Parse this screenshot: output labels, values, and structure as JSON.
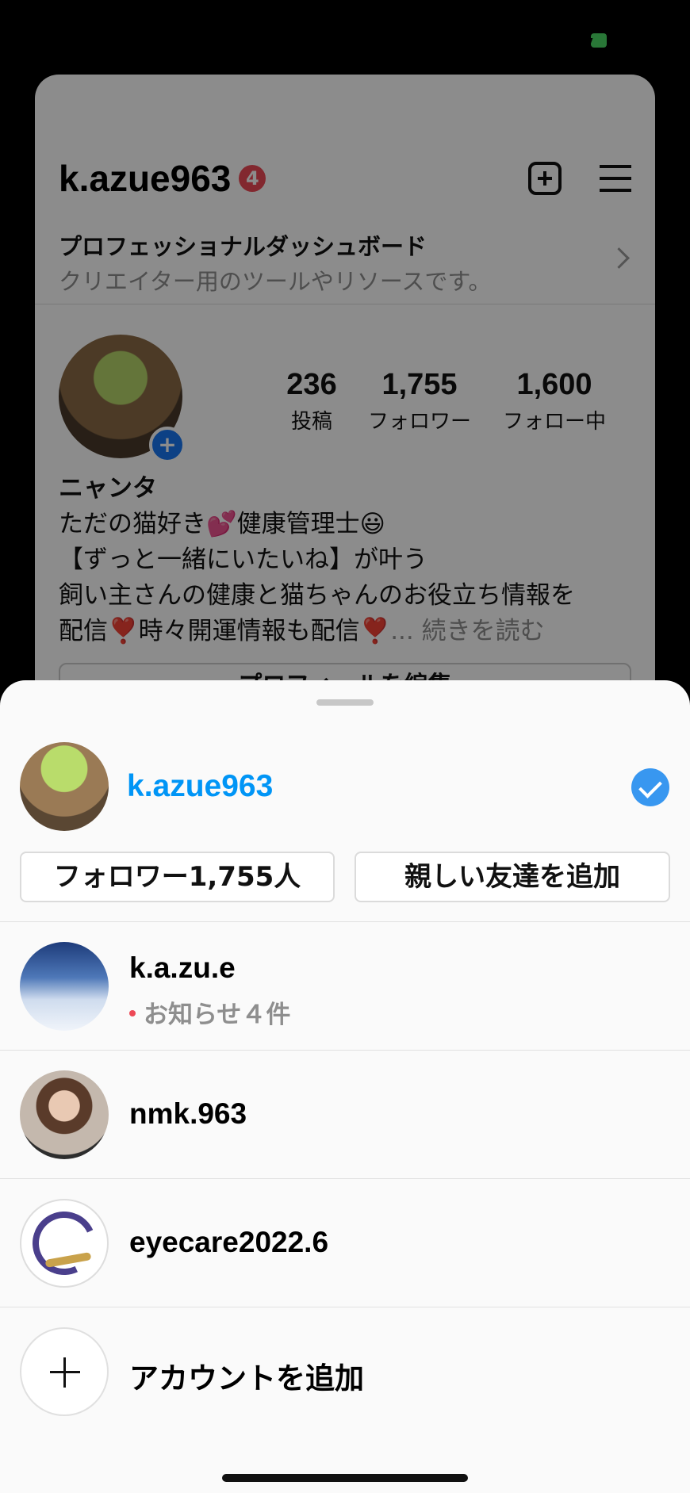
{
  "profile": {
    "username": "k.azue963",
    "notification_count": "4",
    "dashboard_title": "プロフェッショナルダッシュボード",
    "dashboard_subtitle": "クリエイター用のツールやリソースです。",
    "stats": [
      {
        "value": "236",
        "label": "投稿"
      },
      {
        "value": "1,755",
        "label": "フォロワー"
      },
      {
        "value": "1,600",
        "label": "フォロー中"
      }
    ],
    "bio_name": "ニャンタ",
    "bio_lines": [
      "ただの猫好き💕健康管理士😃",
      "【ずっと一緒にいたいね】が叶う",
      "飼い主さんの健康と猫ちゃんのお役立ち情報を",
      "配信❣️時々開運情報も配信❣️"
    ],
    "bio_ellipsis": "...",
    "read_more": "続きを読む",
    "edit_profile": "プロフィールを編集"
  },
  "sheet": {
    "current_account": "k.azue963",
    "followers_button": "フォロワー1,755人",
    "close_friends_button": "親しい友達を追加",
    "accounts": [
      {
        "username": "k.a.zu.e",
        "notice": "お知らせ４件"
      },
      {
        "username": "nmk.963"
      },
      {
        "username": "eyecare2022.6"
      }
    ],
    "add_account": "アカウントを追加"
  },
  "colors": {
    "accent_blue": "#0095f6",
    "check_blue": "#3897f0",
    "badge_red": "#ed4956",
    "status_green": "#4cd964"
  }
}
